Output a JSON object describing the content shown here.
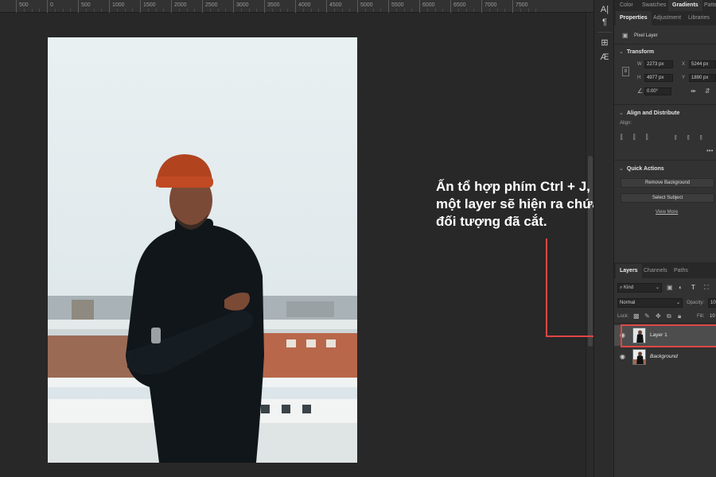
{
  "ruler": {
    "labels": [
      "500",
      "0",
      "500",
      "1000",
      "1500",
      "2000",
      "2500",
      "3000",
      "3500",
      "4000",
      "4500",
      "5000",
      "5500",
      "6000",
      "6500",
      "7000",
      "7500"
    ]
  },
  "annotation": {
    "lines": [
      "Ấn tổ hợp phím Ctrl + J,",
      "một layer sẽ hiện ra chứa",
      "đối tượng đã cắt."
    ]
  },
  "top_tabs": {
    "color": "Color",
    "swatches": "Swatches",
    "gradients": "Gradients",
    "patterns": "Patte"
  },
  "properties": {
    "tabs": {
      "properties": "Properties",
      "adjustments": "Adjustment",
      "libraries": "Libraries"
    },
    "layer_type": "Pixel Layer",
    "transform": {
      "title": "Transform",
      "w_label": "W",
      "w": "2273 px",
      "h_label": "H",
      "h": "4977 px",
      "x_label": "X",
      "x": "5244 px",
      "y_label": "Y",
      "y": "1890 px",
      "angle": "0.00°"
    },
    "align": {
      "title": "Align and Distribute",
      "align_label": "Align:"
    },
    "quick_actions": {
      "title": "Quick Actions",
      "remove_background": "Remove Background",
      "select_subject": "Select Subject",
      "view_more": "View More"
    }
  },
  "layers": {
    "tabs": {
      "layers": "Layers",
      "channels": "Channels",
      "paths": "Paths"
    },
    "filter_kind": "Kind",
    "blend_mode": "Normal",
    "opacity_label": "Opacity:",
    "opacity": "10",
    "lock_label": "Lock:",
    "fill_label": "Fill:",
    "fill": "10",
    "items": [
      {
        "name": "Layer 1",
        "selected": true
      },
      {
        "name": "Background",
        "selected": false
      }
    ]
  },
  "colors": {
    "accent": "#e04646",
    "panel": "#323232",
    "canvas": "#282828"
  }
}
